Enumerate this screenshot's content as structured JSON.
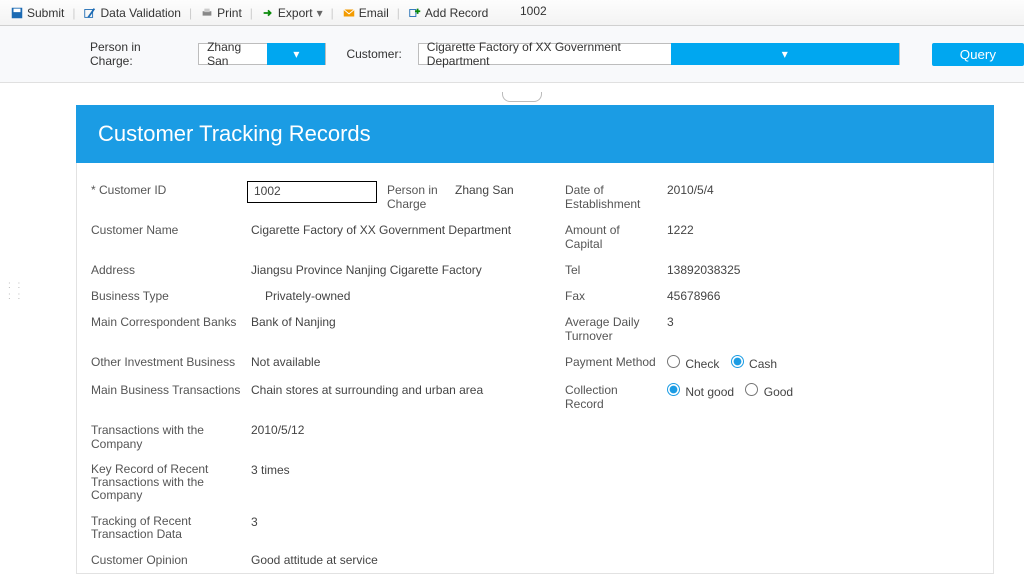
{
  "toolbar": {
    "submit": "Submit",
    "validate": "Data Validation",
    "print": "Print",
    "export": "Export",
    "email": "Email",
    "add": "Add Record",
    "top_id": "1002"
  },
  "filter": {
    "person_label": "Person in Charge:",
    "person_value": "Zhang San",
    "customer_label": "Customer:",
    "customer_value": "Cigarette Factory of XX Government Department",
    "query": "Query"
  },
  "header": {
    "title": "Customer Tracking Records"
  },
  "form": {
    "customer_id_label": "* Customer ID",
    "customer_id": "1002",
    "person_in_charge_label": "Person in Charge",
    "person_in_charge": "Zhang San",
    "doe_label": "Date of Establishment",
    "doe": "2010/5/4",
    "customer_name_label": "Customer Name",
    "customer_name": "Cigarette Factory of XX Government Department",
    "capital_label": "Amount of Capital",
    "capital": "1222",
    "address_label": "Address",
    "address": "Jiangsu Province Nanjing Cigarette Factory",
    "tel_label": "Tel",
    "tel": "13892038325",
    "btype_label": "Business Type",
    "btype": "Privately-owned",
    "fax_label": "Fax",
    "fax": "45678966",
    "banks_label": "Main Correspondent Banks",
    "banks": "Bank of Nanjing",
    "adt_label": "Average Daily Turnover",
    "adt": "3",
    "other_inv_label": "Other Investment Business",
    "other_inv": "Not available",
    "payment_label": "Payment Method",
    "payment_check": "Check",
    "payment_cash": "Cash",
    "mbt_label": "Main Business Transactions",
    "mbt": "Chain stores at surrounding and urban area",
    "collection_label": "Collection Record",
    "collection_notgood": "Not good",
    "collection_good": "Good",
    "twc_label": "Transactions with the Company",
    "twc": "2010/5/12",
    "krr_label": "Key Record of Recent Transactions with the Company",
    "krr": "3 times",
    "trtd_label": "Tracking of Recent Transaction Data",
    "trtd": "3",
    "opinion_label": "Customer Opinion",
    "opinion": "Good attitude at service"
  }
}
